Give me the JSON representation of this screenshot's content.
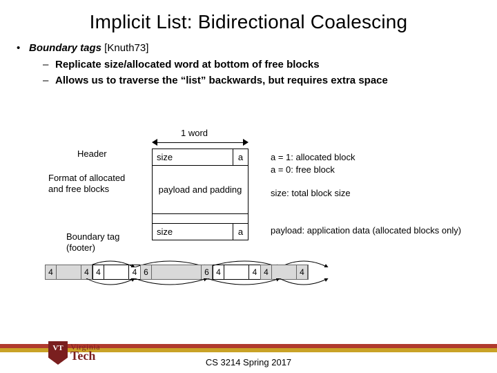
{
  "title": "Implicit List: Bidirectional Coalescing",
  "bullets": {
    "lvl1": "Boundary tags",
    "lvl1_suffix": " [Knuth73]",
    "lvl2a": "Replicate size/allocated word at bottom of free blocks",
    "lvl2b": "Allows us to traverse the “list” backwards, but requires extra space"
  },
  "diagram": {
    "oneword": "1 word",
    "header_label": "Header",
    "format_label": "Format of allocated and free blocks",
    "footer_label": "Boundary tag (footer)",
    "size_label": "size",
    "a_label": "a",
    "payload_label": "payload and padding",
    "note_a1": "a = 1: allocated block",
    "note_a0": "a = 0: free block",
    "note_size": "size: total block size",
    "note_payload": "payload: application data (allocated blocks only)"
  },
  "blocks": {
    "segs": [
      {
        "left": "4",
        "mid": 36,
        "right": "4",
        "gray": true
      },
      {
        "left": "4",
        "mid": 36,
        "right": "4",
        "gray": false
      },
      {
        "left": "6",
        "mid": 72,
        "right": "6",
        "gray": true
      },
      {
        "left": "4",
        "mid": 36,
        "right": "4",
        "gray": false
      },
      {
        "left": "4",
        "mid": 36,
        "right": "4",
        "gray": true
      }
    ]
  },
  "footer": {
    "course": "CS 3214 Spring 2017",
    "logo_top": "Virginia",
    "logo_bottom": "Tech"
  }
}
